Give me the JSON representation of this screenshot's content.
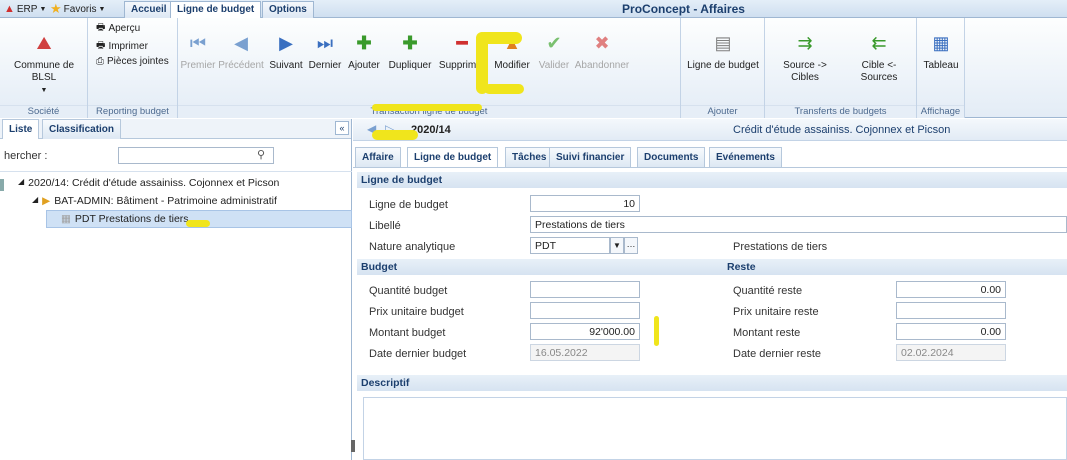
{
  "quick_access": {
    "erp_label": "ERP",
    "favoris_label": "Favoris"
  },
  "ribbon_tabs": [
    "Accueil",
    "Ligne de budget",
    "Options"
  ],
  "app_title": "ProConcept - Affaires",
  "ribbon": {
    "societe": {
      "button": "Commune de BLSL",
      "group": "Société"
    },
    "reporting": {
      "apercu": "Aperçu",
      "imprimer": "Imprimer",
      "pieces": "Pièces jointes",
      "group": "Reporting budget"
    },
    "transaction": {
      "premier": "Premier",
      "precedent": "Précédent",
      "suivant": "Suivant",
      "dernier": "Dernier",
      "ajouter": "Ajouter",
      "dupliquer": "Dupliquer",
      "supprimer": "Supprimer",
      "modifier": "Modifier",
      "valider": "Valider",
      "abandonner": "Abandonner",
      "group": "Transaction ligne de budget"
    },
    "ajouter": {
      "button": "Ligne de budget",
      "group": "Ajouter"
    },
    "transferts": {
      "source": "Source ->",
      "source2": "Cibles",
      "cible": "Cible <-",
      "cible2": "Sources",
      "group": "Transferts de budgets"
    },
    "affichage": {
      "tableau": "Tableau",
      "group": "Affichage"
    }
  },
  "left_panel": {
    "tabs": [
      "Liste",
      "Classification"
    ],
    "search_label": "hercher :",
    "search_value": "",
    "tree": [
      {
        "label": "2020/14: Crédit d'étude assainiss. Cojonnex et Picson"
      },
      {
        "label": "BAT-ADMIN: Bâtiment - Patrimoine administratif"
      },
      {
        "label": "PDT Prestations de tiers"
      }
    ]
  },
  "record": {
    "id": "2020/14",
    "description": "Crédit d'étude assainiss. Cojonnex et Picson"
  },
  "form_tabs": [
    "Affaire",
    "Ligne de budget",
    "Tâches",
    "Suivi financier",
    "Documents",
    "Evénements"
  ],
  "ligne": {
    "section": "Ligne de budget",
    "ligne_label": "Ligne de budget",
    "ligne_value": "10",
    "libelle_label": "Libellé",
    "libelle_value": "Prestations de tiers",
    "nature_label": "Nature analytique",
    "nature_value": "PDT",
    "nature_desc": "Prestations de tiers"
  },
  "budget": {
    "section": "Budget",
    "qte_label": "Quantité budget",
    "qte_value": "",
    "prix_label": "Prix unitaire budget",
    "prix_value": "",
    "montant_label": "Montant budget",
    "montant_value": "92'000.00",
    "date_label": "Date dernier budget",
    "date_value": "16.05.2022"
  },
  "reste": {
    "section": "Reste",
    "qte_label": "Quantité reste",
    "qte_value": "0.00",
    "prix_label": "Prix unitaire reste",
    "prix_value": "",
    "montant_label": "Montant reste",
    "montant_value": "0.00",
    "date_label": "Date dernier reste",
    "date_value": "02.02.2024"
  },
  "descriptif": {
    "section": "Descriptif"
  }
}
